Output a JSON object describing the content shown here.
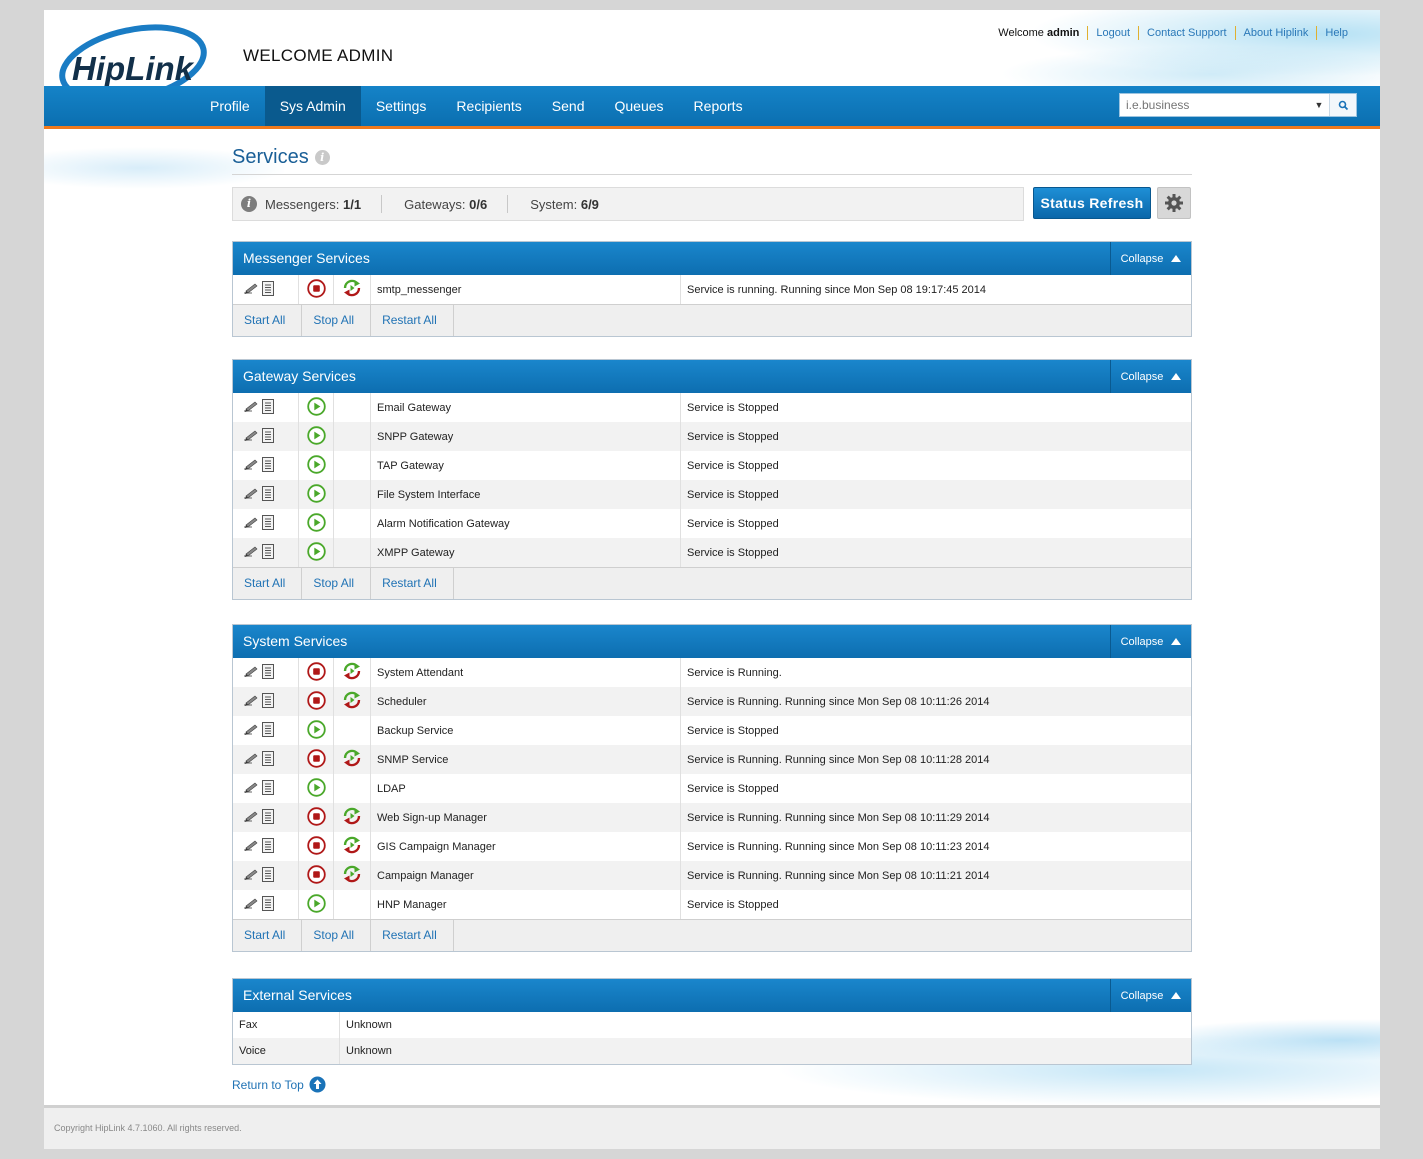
{
  "header": {
    "logo_text": "HipLink",
    "welcome_title": "WELCOME ADMIN",
    "welcome_prefix": "Welcome",
    "username": "admin",
    "links": [
      "Logout",
      "Contact Support",
      "About Hiplink",
      "Help"
    ]
  },
  "nav": {
    "items": [
      "Profile",
      "Sys Admin",
      "Settings",
      "Recipients",
      "Send",
      "Queues",
      "Reports"
    ],
    "active": "Sys Admin"
  },
  "search": {
    "placeholder": "i.e.business"
  },
  "page": {
    "title": "Services"
  },
  "status": {
    "messengers_label": "Messengers:",
    "messengers_value": "1/1",
    "gateways_label": "Gateways:",
    "gateways_value": "0/6",
    "system_label": "System:",
    "system_value": "6/9",
    "refresh_label": "Status Refresh"
  },
  "panel_actions": {
    "collapse": "Collapse",
    "start_all": "Start All",
    "stop_all": "Stop All",
    "restart_all": "Restart All"
  },
  "messenger": {
    "title": "Messenger Services",
    "rows": [
      {
        "name": "smtp_messenger",
        "status": "Service is running. Running since Mon Sep 08 19:17:45 2014",
        "running": true
      }
    ]
  },
  "gateway": {
    "title": "Gateway Services",
    "rows": [
      {
        "name": "Email Gateway",
        "status": "Service is Stopped",
        "running": false
      },
      {
        "name": "SNPP Gateway",
        "status": "Service is Stopped",
        "running": false
      },
      {
        "name": "TAP Gateway",
        "status": "Service is Stopped",
        "running": false
      },
      {
        "name": "File System Interface",
        "status": "Service is Stopped",
        "running": false
      },
      {
        "name": "Alarm Notification Gateway",
        "status": "Service is Stopped",
        "running": false
      },
      {
        "name": "XMPP Gateway",
        "status": "Service is Stopped",
        "running": false
      }
    ]
  },
  "system": {
    "title": "System Services",
    "rows": [
      {
        "name": "System Attendant",
        "status": "Service is Running.",
        "running": true
      },
      {
        "name": "Scheduler",
        "status": "Service is Running. Running since Mon Sep 08 10:11:26 2014",
        "running": true
      },
      {
        "name": "Backup Service",
        "status": "Service is Stopped",
        "running": false
      },
      {
        "name": "SNMP Service",
        "status": "Service is Running. Running since Mon Sep 08 10:11:28 2014",
        "running": true
      },
      {
        "name": "LDAP",
        "status": "Service is Stopped",
        "running": false
      },
      {
        "name": "Web Sign-up Manager",
        "status": "Service is Running. Running since Mon Sep 08 10:11:29 2014",
        "running": true
      },
      {
        "name": "GIS Campaign Manager",
        "status": "Service is Running. Running since Mon Sep 08 10:11:23 2014",
        "running": true
      },
      {
        "name": "Campaign Manager",
        "status": "Service is Running. Running since Mon Sep 08 10:11:21 2014",
        "running": true
      },
      {
        "name": "HNP Manager",
        "status": "Service is Stopped",
        "running": false
      }
    ]
  },
  "external": {
    "title": "External Services",
    "rows": [
      {
        "name": "Fax",
        "status": "Unknown"
      },
      {
        "name": "Voice",
        "status": "Unknown"
      }
    ]
  },
  "return_top": "Return to Top",
  "footer": {
    "copyright": "Copyright HipLink 4.7.1060. All rights reserved."
  },
  "colors": {
    "brand_blue": "#0d6eb0",
    "accent_orange": "#f07a1d",
    "stop_red": "#b01818",
    "start_green": "#4aa82a"
  }
}
